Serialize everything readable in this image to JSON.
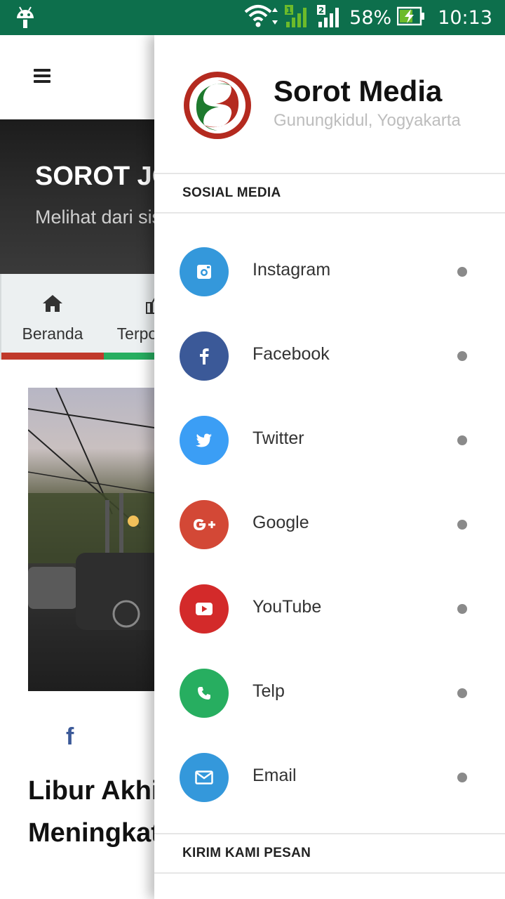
{
  "status_bar": {
    "battery": "58%",
    "time": "10:13",
    "sim1": "1",
    "sim2": "2",
    "background": "#0d6f4c"
  },
  "page": {
    "hero_title": "SOROT JOGJA",
    "hero_subtitle": "Melihat dari sisi berbeda",
    "tabs": [
      {
        "label": "Beranda",
        "icon": "home-icon",
        "bar_color": "#c0392b"
      },
      {
        "label": "Terpopuler",
        "icon": "thumbs-up-icon",
        "bar_color": "#27ae60"
      }
    ],
    "post_title": "Libur Akhir Tahun, Kendaraan Meningkat, Waspadai"
  },
  "drawer": {
    "brand": "Sorot Media",
    "location": "Gunungkidul, Yogyakarta",
    "section_social": "SOSIAL MEDIA",
    "section_message": "KIRIM KAMI PESAN",
    "items": [
      {
        "label": "Instagram",
        "icon": "instagram-icon",
        "color": "#3498db"
      },
      {
        "label": "Facebook",
        "icon": "facebook-icon",
        "color": "#3b5998"
      },
      {
        "label": "Twitter",
        "icon": "twitter-icon",
        "color": "#3b9ef5"
      },
      {
        "label": "Google",
        "icon": "google-plus-icon",
        "color": "#d34836"
      },
      {
        "label": "YouTube",
        "icon": "youtube-icon",
        "color": "#d32a2a"
      },
      {
        "label": "Telp",
        "icon": "phone-icon",
        "color": "#27ae60"
      },
      {
        "label": "Email",
        "icon": "email-icon",
        "color": "#3498db"
      }
    ]
  }
}
